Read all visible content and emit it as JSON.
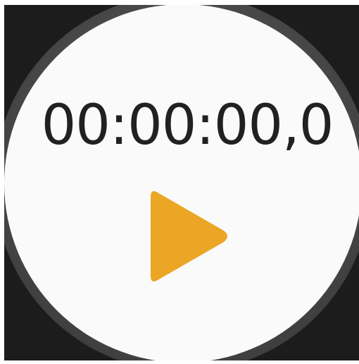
{
  "stopwatch": {
    "time_display": "00:00:00,0",
    "accent_color": "#EBA626",
    "play_icon": "play-icon"
  }
}
